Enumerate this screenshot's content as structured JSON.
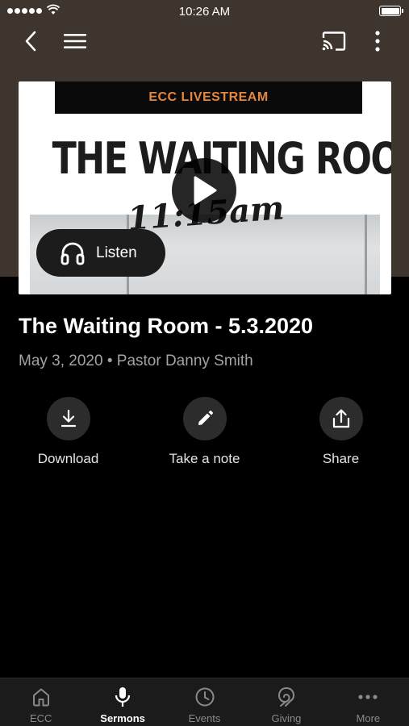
{
  "status_bar": {
    "time": "10:26 AM"
  },
  "hero": {
    "banner_text": "ECC LIVESTREAM",
    "title_text": "THE WAITING ROOM",
    "time_text": "11:15am",
    "listen_label": "Listen"
  },
  "sermon": {
    "title": "The Waiting Room - 5.3.2020",
    "meta": "May 3, 2020 • Pastor Danny Smith"
  },
  "actions": [
    {
      "label": "Download",
      "icon": "download-icon"
    },
    {
      "label": "Take a note",
      "icon": "pencil-icon"
    },
    {
      "label": "Share",
      "icon": "share-icon"
    }
  ],
  "tabs": [
    {
      "label": "ECC",
      "icon": "home-icon",
      "active": false
    },
    {
      "label": "Sermons",
      "icon": "microphone-icon",
      "active": true
    },
    {
      "label": "Events",
      "icon": "clock-icon",
      "active": false
    },
    {
      "label": "Giving",
      "icon": "giving-icon",
      "active": false
    },
    {
      "label": "More",
      "icon": "more-icon",
      "active": false
    }
  ],
  "colors": {
    "header_bg": "#3d352e",
    "banner_accent": "#e6863a",
    "action_circle": "#2c2c2c",
    "tab_bar_bg": "#1b1b1b",
    "tab_inactive": "#8a8a8a"
  }
}
